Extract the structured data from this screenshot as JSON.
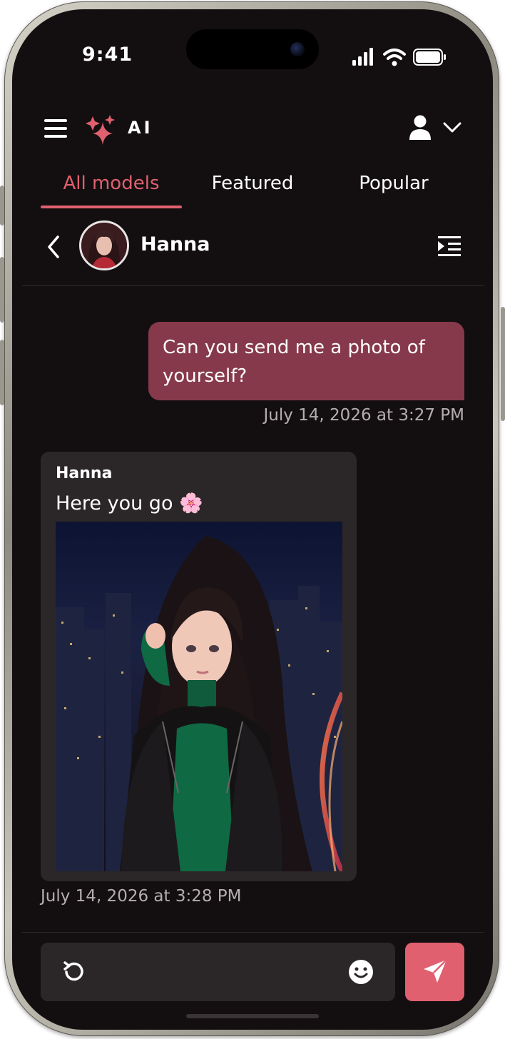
{
  "status_bar": {
    "time": "9:41"
  },
  "header": {
    "logo_text": "AI"
  },
  "tabs": [
    {
      "label": "All models",
      "active": true
    },
    {
      "label": "Featured",
      "active": false
    },
    {
      "label": "Popular",
      "active": false
    }
  ],
  "chat": {
    "contact_name": "Hanna",
    "messages": [
      {
        "from": "user",
        "text": "Can you send me a photo of yourself?",
        "timestamp": "July 14, 2026 at 3:27 PM"
      },
      {
        "from": "bot",
        "sender": "Hanna",
        "text": "Here you go 🌸",
        "timestamp": "July 14, 2026 at 3:28 PM"
      }
    ]
  },
  "colors": {
    "accent": "#e0606f",
    "user_bubble": "#86394a",
    "background": "#130f10",
    "card": "#2b2627"
  },
  "icons": [
    "menu-icon",
    "logo-icon",
    "user-icon",
    "chevron-down-icon",
    "back-icon",
    "chat-list-icon",
    "regenerate-icon",
    "emoji-icon",
    "send-icon",
    "signal-icon",
    "wifi-icon",
    "battery-icon"
  ]
}
